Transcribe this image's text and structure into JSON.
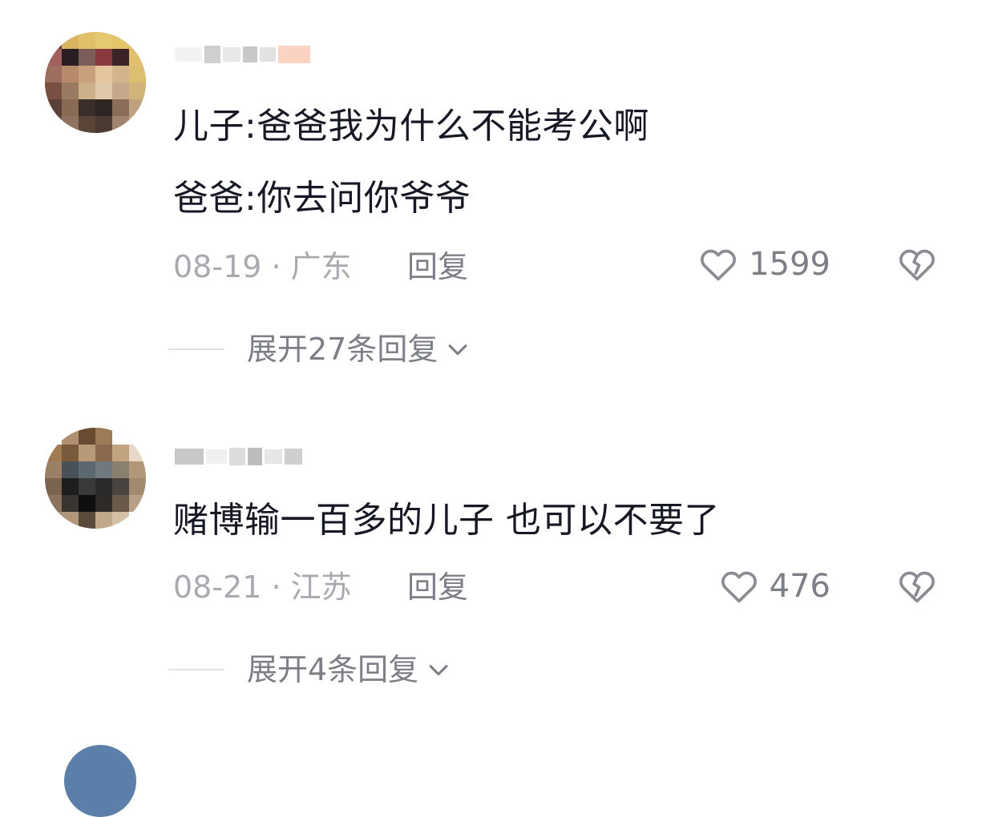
{
  "comments": [
    {
      "avatar_icon": "pixelated-avatar",
      "lines": [
        "儿子:爸爸我为什么不能考公啊",
        "爸爸:你去问你爷爷"
      ],
      "date_location": "08-19 · 广东",
      "reply_label": "回复",
      "like_count": "1599",
      "expand_label": "展开27条回复"
    },
    {
      "avatar_icon": "pixelated-avatar",
      "lines": [
        "赌博输一百多的儿子  也可以不要了"
      ],
      "date_location": "08-21 · 江苏",
      "reply_label": "回复",
      "like_count": "476",
      "expand_label": "展开4条回复"
    }
  ],
  "colors": {
    "primary_text": "#161823",
    "secondary_text": "#7d7f86",
    "meta_text": "#a8aab0",
    "divider": "#e2e3e6"
  }
}
